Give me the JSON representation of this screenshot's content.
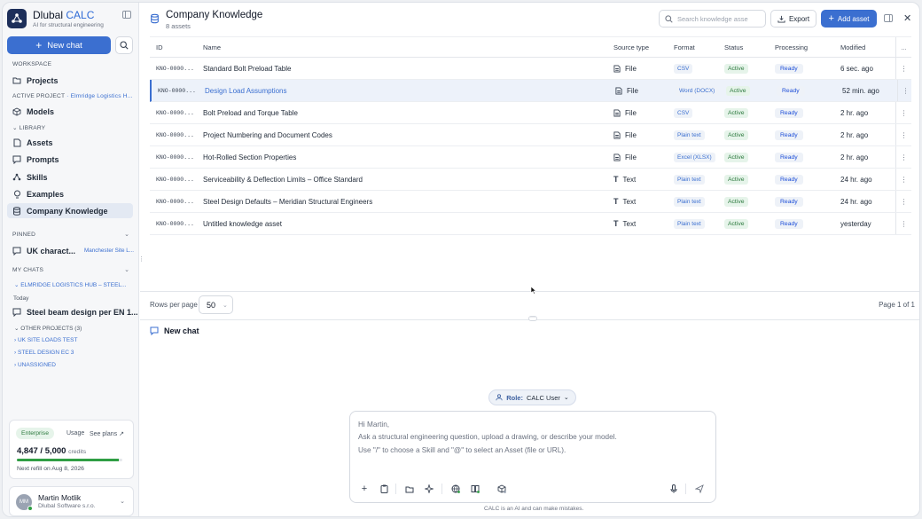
{
  "app": {
    "name": "Dlubal",
    "name_accent": "CALC",
    "tagline": "AI for structural engineering"
  },
  "sidebar": {
    "new_chat_label": "New chat",
    "workspace_label": "WORKSPACE",
    "projects_label": "Projects",
    "active_project_label": "ACTIVE PROJECT",
    "active_project_name": "· Elmridge Logistics H...",
    "models_label": "Models",
    "library_label": "LIBRARY",
    "library_items": [
      "Assets",
      "Prompts",
      "Skills",
      "Examples",
      "Company Knowledge"
    ],
    "pinned_label": "PINNED",
    "pinned_item": "UK charact...",
    "pinned_item_project": "Manchester Site L...",
    "my_chats_label": "MY CHATS",
    "current_project": "ELMRIDGE LOGISTICS HUB – STEEL...",
    "today_label": "Today",
    "today_chat": "Steel beam design per EN 1...",
    "other_projects_label": "OTHER PROJECTS (3)",
    "other_projects": [
      "UK SITE LOADS TEST",
      "STEEL DESIGN EC 3",
      "UNASSIGNED"
    ]
  },
  "plan": {
    "badge": "Enterprise",
    "usage_label": "Usage",
    "see_plans_label": "See plans",
    "credits_used": "4,847 / 5,000",
    "credits_word": "credits",
    "credits_fraction": 0.969,
    "refill": "Next refill on Aug 8, 2026"
  },
  "user": {
    "initials": "MM",
    "name": "Martin Motlik",
    "org": "Dlubal Software s.r.o."
  },
  "header": {
    "title": "Company Knowledge",
    "subtitle": "8 assets",
    "search_placeholder": "Search knowledge asse",
    "export_label": "Export",
    "add_asset_label": "Add asset"
  },
  "table": {
    "columns": [
      "ID",
      "Name",
      "Source type",
      "Format",
      "Status",
      "Processing",
      "Modified",
      "..."
    ],
    "rows": [
      {
        "id": "KNO-0000...",
        "name": "Standard Bolt Preload Table",
        "source": "File",
        "format": "CSV",
        "status": "Active",
        "processing": "Ready",
        "modified": "6 sec. ago"
      },
      {
        "id": "KNO-0000...",
        "name": "Design Load Assumptions",
        "source": "File",
        "format": "Word (DOCX)",
        "status": "Active",
        "processing": "Ready",
        "modified": "52 min. ago"
      },
      {
        "id": "KNO-0000...",
        "name": "Bolt Preload and Torque Table",
        "source": "File",
        "format": "CSV",
        "status": "Active",
        "processing": "Ready",
        "modified": "2 hr. ago"
      },
      {
        "id": "KNO-0000...",
        "name": "Project Numbering and Document Codes",
        "source": "File",
        "format": "Plain text",
        "status": "Active",
        "processing": "Ready",
        "modified": "2 hr. ago"
      },
      {
        "id": "KNO-0000...",
        "name": "Hot-Rolled Section Properties",
        "source": "File",
        "format": "Excel (XLSX)",
        "status": "Active",
        "processing": "Ready",
        "modified": "2 hr. ago"
      },
      {
        "id": "KNO-0000...",
        "name": "Serviceability & Deflection Limits – Office Standard",
        "source": "Text",
        "format": "Plain text",
        "status": "Active",
        "processing": "Ready",
        "modified": "24 hr. ago"
      },
      {
        "id": "KNO-0000...",
        "name": "Steel Design Defaults – Meridian Structural Engineers",
        "source": "Text",
        "format": "Plain text",
        "status": "Active",
        "processing": "Ready",
        "modified": "24 hr. ago"
      },
      {
        "id": "KNO-0000...",
        "name": "Untitled knowledge asset",
        "source": "Text",
        "format": "Plain text",
        "status": "Active",
        "processing": "Ready",
        "modified": "yesterday"
      }
    ]
  },
  "pager": {
    "rows_per_page_label": "Rows per page",
    "rows_per_page": "50",
    "page_info": "Page 1 of 1"
  },
  "chat": {
    "title": "New chat",
    "role_label": "Role:",
    "role_value": "CALC User",
    "greeting": "Hi Martin,",
    "line1": "Ask a structural engineering question, upload a drawing, or describe your model.",
    "line2": "Use \"/\" to choose a Skill and \"@\" to select an Asset (file or URL).",
    "disclaimer": "CALC is an AI and can make mistakes."
  },
  "colors": {
    "accent": "#3b6fd0",
    "status_green": "#2d7a3f",
    "sidebar_bg": "#f6f7f9"
  }
}
